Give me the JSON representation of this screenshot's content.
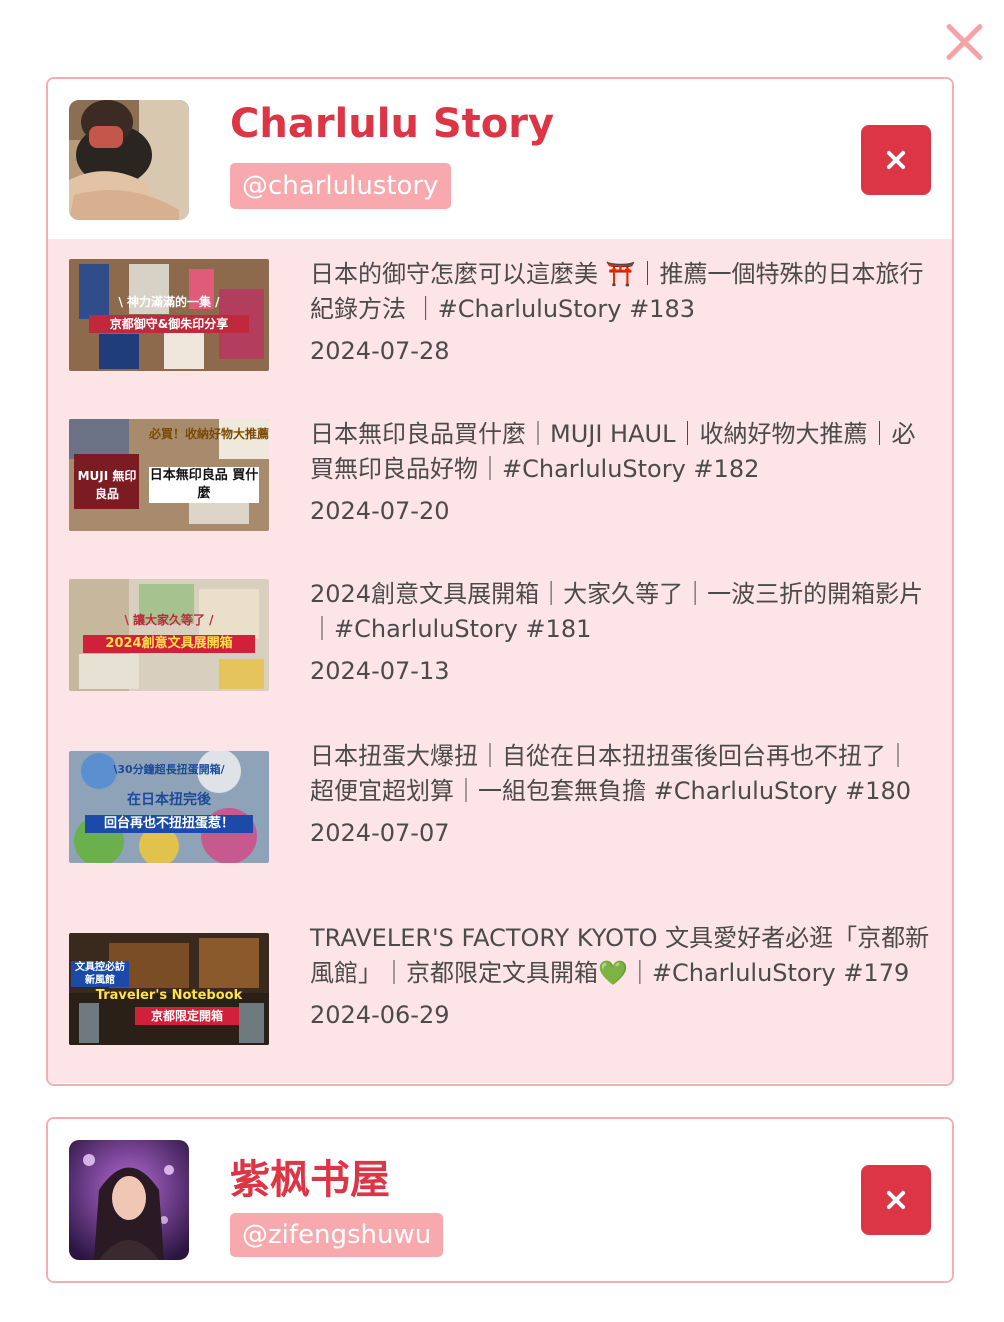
{
  "page": {
    "close_icon": "close-x-icon"
  },
  "channels": [
    {
      "name": "Charlulu Story",
      "handle": "@charlulustory",
      "remove_icon": "close-icon",
      "avatar": "avatar-photo",
      "videos": [
        {
          "title": "日本的御守怎麼可以這麼美 ⛩️｜推薦一個特殊的日本旅行紀錄方法 ｜#CharluluStory #183",
          "date": "2024-07-28",
          "thumb_caption": [
            "\\ 神力滿滿的一集 /",
            "京都御守&御朱印分享"
          ]
        },
        {
          "title": "日本無印良品買什麼｜MUJI HAUL｜收納好物大推薦｜必買無印良品好物｜#CharluluStory #182",
          "date": "2024-07-20",
          "thumb_caption": [
            "必買！收納好物大推薦",
            "MUJI 無印良品",
            "日本無印良品 買什麼"
          ]
        },
        {
          "title": "2024創意文具展開箱｜大家久等了｜一波三折的開箱影片｜#CharluluStory #181",
          "date": "2024-07-13",
          "thumb_caption": [
            "\\ 讓大家久等了 /",
            "2024創意文具展開箱"
          ]
        },
        {
          "title": "日本扭蛋大爆扭｜自從在日本扭扭蛋後回台再也不扭了｜超便宜超划算｜一組包套無負擔 #CharluluStory #180",
          "date": "2024-07-07",
          "thumb_caption": [
            "\\30分鐘超長扭蛋開箱/",
            "在日本扭完後",
            "回台再也不扭扭蛋惹！"
          ]
        },
        {
          "title": "TRAVELER'S FACTORY KYOTO 文具愛好者必逛「京都新風館」｜京都限定文具開箱💚｜#CharluluStory #179",
          "date": "2024-06-29",
          "thumb_caption": [
            "文具控必訪 新風館",
            "Traveler's Notebook",
            "京都限定開箱"
          ]
        }
      ]
    },
    {
      "name": "紫枫书屋",
      "handle": "@zifengshuwu",
      "remove_icon": "close-icon",
      "avatar": "avatar-illustration",
      "videos": []
    }
  ]
}
